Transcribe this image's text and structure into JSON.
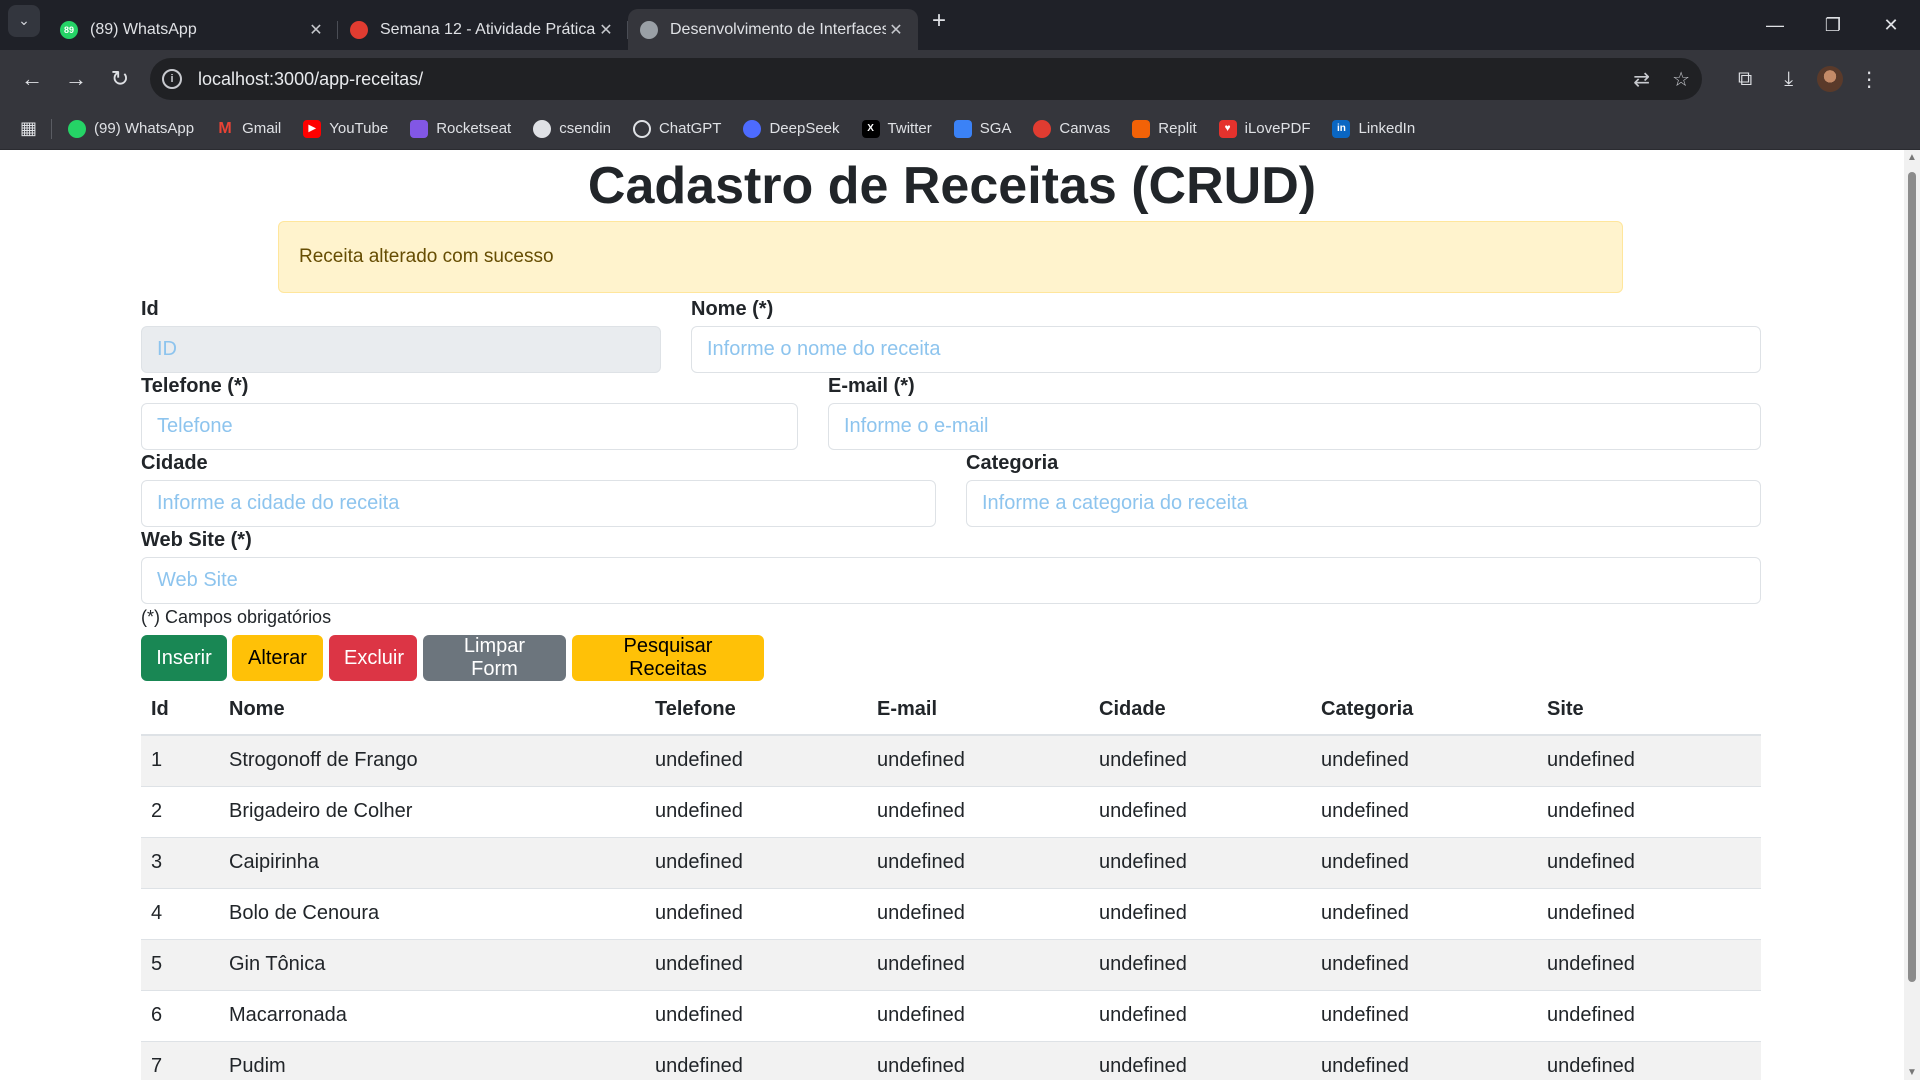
{
  "browser": {
    "tabs": [
      {
        "title": "(89) WhatsApp",
        "icon": "whatsapp-icon",
        "icon_color": "#25d366",
        "badge": "89"
      },
      {
        "title": "Semana 12 - Atividade Prática",
        "icon": "canvas-icon",
        "icon_color": "#e03c31"
      },
      {
        "title": "Desenvolvimento de Interfaces",
        "icon": "globe-icon",
        "icon_color": "#9aa0a6"
      }
    ],
    "url": "localhost:3000/app-receitas/",
    "bookmarks": [
      {
        "label": "(99) WhatsApp",
        "icon": "whatsapp-icon",
        "color": "#25d366"
      },
      {
        "label": "Gmail",
        "icon": "gmail-icon",
        "color": "#ea4335"
      },
      {
        "label": "YouTube",
        "icon": "youtube-icon",
        "color": "#ff0000"
      },
      {
        "label": "Rocketseat",
        "icon": "rocketseat-icon",
        "color": "#8257e5"
      },
      {
        "label": "csendin",
        "icon": "github-icon",
        "color": "#dfe1e5"
      },
      {
        "label": "ChatGPT",
        "icon": "chatgpt-icon",
        "color": "#dfe1e5"
      },
      {
        "label": "DeepSeek",
        "icon": "deepseek-icon",
        "color": "#4d6bfe"
      },
      {
        "label": "Twitter",
        "icon": "x-icon",
        "color": "#000000"
      },
      {
        "label": "SGA",
        "icon": "sga-icon",
        "color": "#3b82f6"
      },
      {
        "label": "Canvas",
        "icon": "canvas-icon",
        "color": "#e03c31"
      },
      {
        "label": "Replit",
        "icon": "replit-icon",
        "color": "#f26207"
      },
      {
        "label": "iLovePDF",
        "icon": "ilovepdf-icon",
        "color": "#e5322d"
      },
      {
        "label": "LinkedIn",
        "icon": "linkedin-icon",
        "color": "#0a66c2"
      }
    ]
  },
  "page": {
    "title": "Cadastro de Receitas (CRUD)",
    "alert": "Receita alterado com sucesso",
    "fields": {
      "id": {
        "label": "Id",
        "placeholder": "ID"
      },
      "nome": {
        "label": "Nome (*)",
        "placeholder": "Informe o nome do receita"
      },
      "telefone": {
        "label": "Telefone (*)",
        "placeholder": "Telefone"
      },
      "email": {
        "label": "E-mail (*)",
        "placeholder": "Informe o e-mail"
      },
      "cidade": {
        "label": "Cidade",
        "placeholder": "Informe a cidade do receita"
      },
      "categoria": {
        "label": "Categoria",
        "placeholder": "Informe a categoria do receita"
      },
      "site": {
        "label": "Web Site (*)",
        "placeholder": "Web Site"
      }
    },
    "required_note": "(*) Campos obrigatórios",
    "buttons": {
      "inserir": "Inserir",
      "alterar": "Alterar",
      "excluir": "Excluir",
      "limpar": "Limpar Form",
      "pesquisar": "Pesquisar Receitas"
    },
    "table": {
      "headers": [
        "Id",
        "Nome",
        "Telefone",
        "E-mail",
        "Cidade",
        "Categoria",
        "Site"
      ],
      "rows": [
        [
          "1",
          "Strogonoff de Frango",
          "undefined",
          "undefined",
          "undefined",
          "undefined",
          "undefined"
        ],
        [
          "2",
          "Brigadeiro de Colher",
          "undefined",
          "undefined",
          "undefined",
          "undefined",
          "undefined"
        ],
        [
          "3",
          "Caipirinha",
          "undefined",
          "undefined",
          "undefined",
          "undefined",
          "undefined"
        ],
        [
          "4",
          "Bolo de Cenoura",
          "undefined",
          "undefined",
          "undefined",
          "undefined",
          "undefined"
        ],
        [
          "5",
          "Gin Tônica",
          "undefined",
          "undefined",
          "undefined",
          "undefined",
          "undefined"
        ],
        [
          "6",
          "Macarronada",
          "undefined",
          "undefined",
          "undefined",
          "undefined",
          "undefined"
        ],
        [
          "7",
          "Pudim",
          "undefined",
          "undefined",
          "undefined",
          "undefined",
          "undefined"
        ]
      ]
    }
  }
}
